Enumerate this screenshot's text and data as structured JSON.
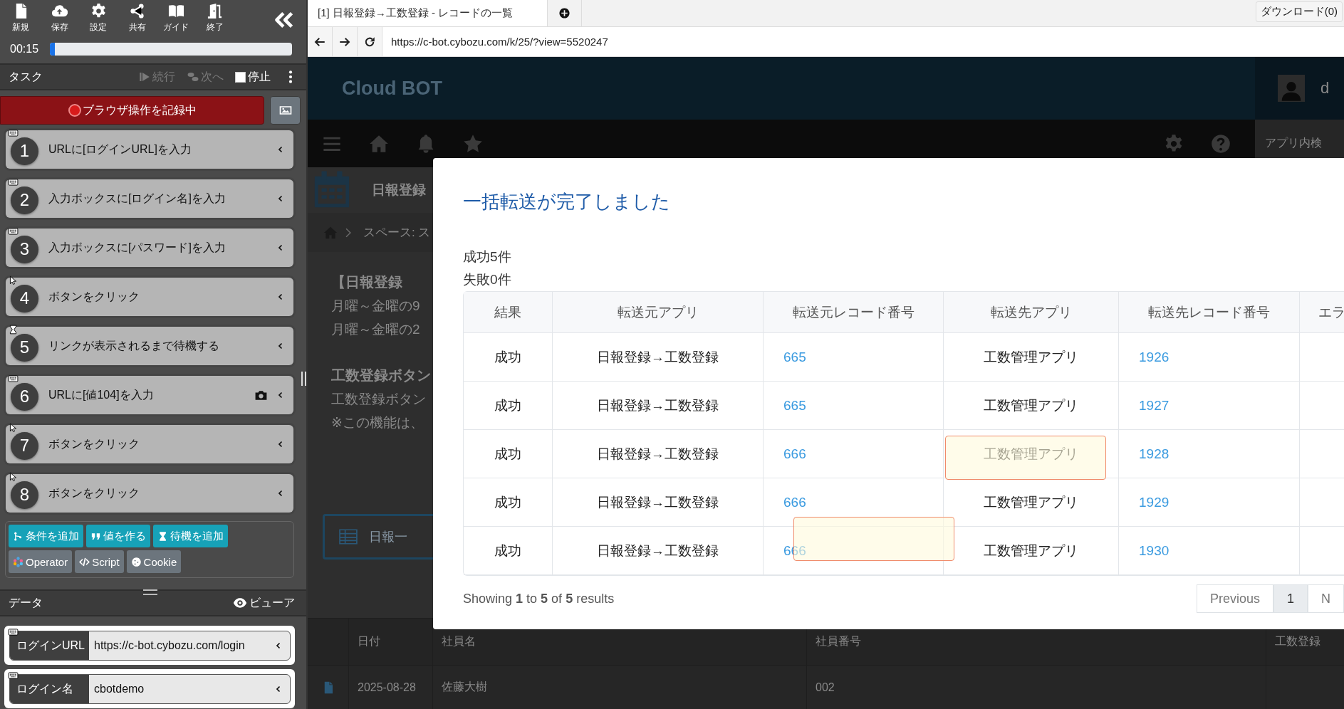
{
  "toolbar": {
    "buttons": [
      {
        "label": "新規",
        "kind": "new"
      },
      {
        "label": "保存",
        "kind": "save"
      },
      {
        "label": "設定",
        "kind": "settings"
      },
      {
        "label": "共有",
        "kind": "share"
      },
      {
        "label": "ガイド",
        "kind": "guide"
      },
      {
        "label": "終了",
        "kind": "exit"
      }
    ]
  },
  "timer": {
    "time": "00:15",
    "level": 0.02
  },
  "task_header": {
    "title": "タスク",
    "actions": [
      {
        "label": "続行",
        "kind": "play",
        "disabled": true
      },
      {
        "label": "次へ",
        "kind": "next",
        "disabled": true
      }
    ],
    "stop": {
      "label": "停止",
      "checked": false
    }
  },
  "record_button": {
    "label": "ブラウザ操作を記録中"
  },
  "steps": [
    {
      "number": "1",
      "text": "URLに[ログインURL]を入力",
      "kind": "keyboard",
      "screenshot": false
    },
    {
      "number": "2",
      "text": "入力ボックスに[ログイン名]を入力",
      "kind": "keyboard",
      "screenshot": false
    },
    {
      "number": "3",
      "text": "入力ボックスに[パスワード]を入力",
      "kind": "keyboard",
      "screenshot": false
    },
    {
      "number": "4",
      "text": "ボタンをクリック",
      "kind": "click",
      "screenshot": false
    },
    {
      "number": "5",
      "text": "リンクが表示されるまで待機する",
      "kind": "wait",
      "screenshot": false
    },
    {
      "number": "6",
      "text": "URLに[値104]を入力",
      "kind": "keyboard",
      "screenshot": true
    },
    {
      "number": "7",
      "text": "ボタンをクリック",
      "kind": "click",
      "screenshot": false
    },
    {
      "number": "8",
      "text": "ボタンをクリック",
      "kind": "click",
      "screenshot": false
    }
  ],
  "add_buttons": [
    {
      "label": "条件を追加",
      "kind": "branch"
    },
    {
      "label": "値を作る",
      "kind": "quote"
    },
    {
      "label": "待機を追加",
      "kind": "wait"
    }
  ],
  "tool_buttons": [
    {
      "label": "Operator",
      "kind": "operator"
    },
    {
      "label": "Script",
      "kind": "code"
    },
    {
      "label": "Cookie",
      "kind": "cookie"
    }
  ],
  "data_header": {
    "title": "データ",
    "viewer": "ビューア"
  },
  "data_fields": [
    {
      "label": "ログインURL",
      "value": "https://c-bot.cybozu.com/login"
    },
    {
      "label": "ログイン名",
      "value": "cbotdemo"
    }
  ],
  "browser": {
    "tabs": [
      {
        "label": "[1] 日報登録→工数登録 - レコードの一覧",
        "selected": true
      }
    ],
    "download": "ダウンロード(0)",
    "url": "https://c-bot.cybozu.com/k/25/?view=5520247"
  },
  "page": {
    "brand": "Cloud BOT",
    "user_initial": "d",
    "search": "アプリ内検",
    "app_title": "日報登録",
    "breadcrumb": "スペース: ス",
    "description": [
      {
        "text": "【日報登録",
        "bold": true
      },
      {
        "text": "月曜～金曜の9",
        "bold": false
      },
      {
        "text": "月曜～金曜の2",
        "bold": false
      },
      {
        "text": "工数登録ボタン",
        "bold": true
      },
      {
        "text": "工数登録ボタン",
        "bold": false
      },
      {
        "text": "※この機能は、",
        "bold": false
      }
    ],
    "list_button": "日報一",
    "table": {
      "columns": [
        "日付",
        "社員名",
        "社員番号",
        "工数登録"
      ],
      "rows": [
        [
          "2025-08-28",
          "佐藤大樹",
          "002"
        ]
      ]
    }
  },
  "modal": {
    "title": "一括転送が完了しました",
    "summary": [
      "成功5件",
      "失敗0件"
    ],
    "columns": [
      "結果",
      "転送元アプリ",
      "転送元レコード番号",
      "転送先アプリ",
      "転送先レコード番号",
      "エラ"
    ],
    "rows": [
      {
        "result": "成功",
        "source_app": "日報登録→工数登録",
        "source_record": "665",
        "target_app": "工数管理アプリ",
        "target_record": "1926"
      },
      {
        "result": "成功",
        "source_app": "日報登録→工数登録",
        "source_record": "665",
        "target_app": "工数管理アプリ",
        "target_record": "1927"
      },
      {
        "result": "成功",
        "source_app": "日報登録→工数登録",
        "source_record": "666",
        "target_app": "工数管理アプリ",
        "target_record": "1928"
      },
      {
        "result": "成功",
        "source_app": "日報登録→工数登録",
        "source_record": "666",
        "target_app": "工数管理アプリ",
        "target_record": "1929"
      },
      {
        "result": "成功",
        "source_app": "日報登録→工数登録",
        "source_record": "666",
        "target_app": "工数管理アプリ",
        "target_record": "1930"
      }
    ],
    "footer": "Showing **1** to **5** of **5** results",
    "pagination": [
      {
        "label": "Previous",
        "selected": false
      },
      {
        "label": "1",
        "selected": true
      },
      {
        "label": "N",
        "selected": false
      }
    ]
  }
}
